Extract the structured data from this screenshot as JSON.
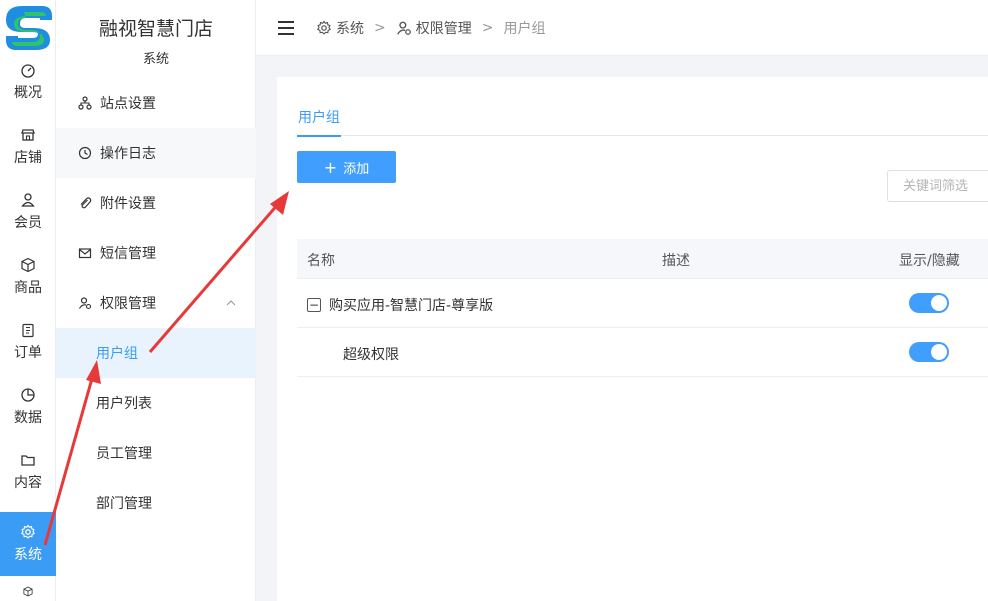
{
  "app": {
    "brand": "融视智慧门店",
    "section": "系统"
  },
  "rail": [
    {
      "label": "概况",
      "icon": "gauge-icon"
    },
    {
      "label": "店铺",
      "icon": "store-icon"
    },
    {
      "label": "会员",
      "icon": "user-icon"
    },
    {
      "label": "商品",
      "icon": "box-icon"
    },
    {
      "label": "订单",
      "icon": "clipboard-icon"
    },
    {
      "label": "数据",
      "icon": "pie-chart-icon"
    },
    {
      "label": "内容",
      "icon": "folder-icon"
    },
    {
      "label": "系统",
      "icon": "gear-icon",
      "active": true
    }
  ],
  "sidebar": {
    "items": [
      {
        "label": "站点设置",
        "icon": "sitemap-icon"
      },
      {
        "label": "操作日志",
        "icon": "history-icon"
      },
      {
        "label": "附件设置",
        "icon": "paperclip-icon"
      },
      {
        "label": "短信管理",
        "icon": "mail-icon"
      },
      {
        "label": "权限管理",
        "icon": "user-lock-icon"
      }
    ],
    "sub_items": [
      {
        "label": "用户组",
        "active": true
      },
      {
        "label": "用户列表"
      },
      {
        "label": "员工管理"
      },
      {
        "label": "部门管理"
      }
    ]
  },
  "breadcrumb": {
    "level1": "系统",
    "level2": "权限管理",
    "current": "用户组",
    "separator": ">"
  },
  "main": {
    "tab": "用户组",
    "add_button": "添加",
    "add_button_plus": "+",
    "filter_placeholder": "关键词筛选",
    "table": {
      "headers": {
        "name": "名称",
        "desc": "描述",
        "toggle": "显示/隐藏"
      },
      "rows": [
        {
          "name": "购买应用-智慧门店-尊享版",
          "expander": "−",
          "visible": true
        },
        {
          "name": "超级权限",
          "visible": true
        }
      ]
    }
  },
  "colors": {
    "accent": "#409eff",
    "annotation": "#e8393a"
  }
}
